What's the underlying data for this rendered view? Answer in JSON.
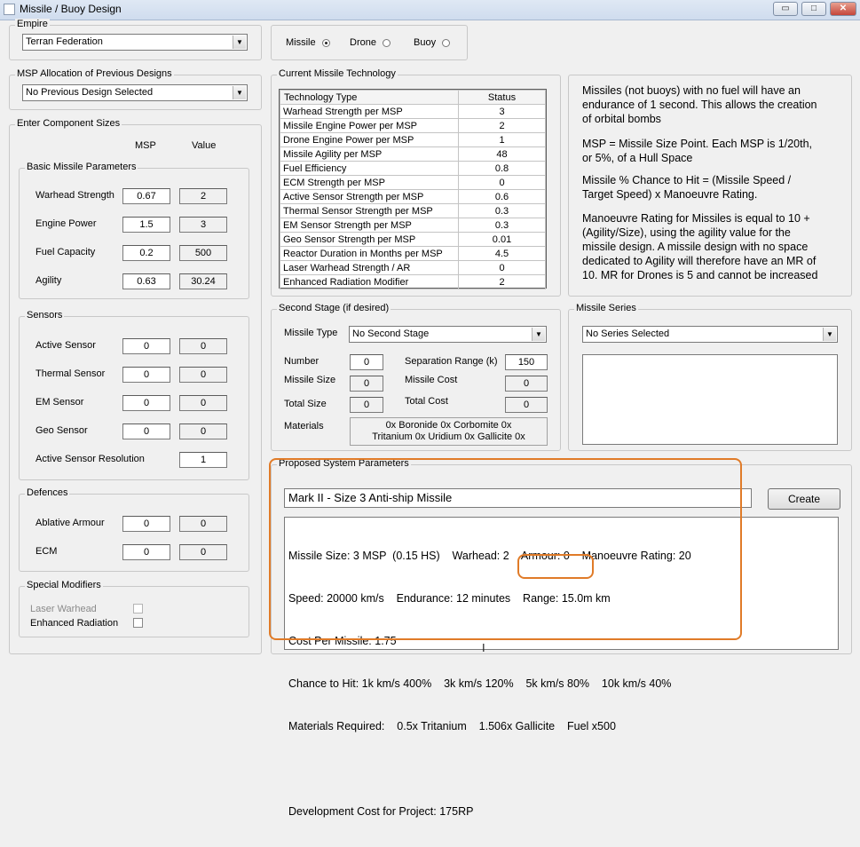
{
  "window": {
    "title": "Missile / Buoy Design",
    "min": "▭",
    "max": "□",
    "close": "✕"
  },
  "empire": {
    "legend": "Empire",
    "selected": "Terran Federation"
  },
  "msp_alloc": {
    "legend": "MSP Allocation of Previous Designs",
    "selected": "No Previous Design Selected"
  },
  "type_select": {
    "missile": "Missile",
    "drone": "Drone",
    "buoy": "Buoy",
    "selected": "Missile"
  },
  "components": {
    "legend": "Enter Component Sizes",
    "col_msp": "MSP",
    "col_value": "Value",
    "basic": {
      "legend": "Basic Missile Parameters",
      "rows": [
        {
          "label": "Warhead Strength",
          "msp": "0.67",
          "value": "2"
        },
        {
          "label": "Engine Power",
          "msp": "1.5",
          "value": "3"
        },
        {
          "label": "Fuel Capacity",
          "msp": "0.2",
          "value": "500"
        },
        {
          "label": "Agility",
          "msp": "0.63",
          "value": "30.24"
        }
      ]
    },
    "sensors": {
      "legend": "Sensors",
      "rows": [
        {
          "label": "Active Sensor",
          "msp": "0",
          "value": "0"
        },
        {
          "label": "Thermal Sensor",
          "msp": "0",
          "value": "0"
        },
        {
          "label": "EM Sensor",
          "msp": "0",
          "value": "0"
        },
        {
          "label": "Geo Sensor",
          "msp": "0",
          "value": "0"
        }
      ],
      "resolution_label": "Active Sensor Resolution",
      "resolution_value": "1"
    },
    "defences": {
      "legend": "Defences",
      "rows": [
        {
          "label": "Ablative Armour",
          "msp": "0",
          "value": "0"
        },
        {
          "label": "ECM",
          "msp": "0",
          "value": "0"
        }
      ]
    },
    "special": {
      "legend": "Special Modifiers",
      "laser": "Laser Warhead",
      "enhanced": "Enhanced Radiation"
    }
  },
  "tech": {
    "legend": "Current Missile Technology",
    "col_type": "Technology Type",
    "col_status": "Status",
    "rows": [
      {
        "type": "Warhead Strength per MSP",
        "status": "3"
      },
      {
        "type": "Missile Engine Power per MSP",
        "status": "2"
      },
      {
        "type": "Drone Engine Power per MSP",
        "status": "1"
      },
      {
        "type": "Missile Agility per MSP",
        "status": "48"
      },
      {
        "type": "Fuel Efficiency",
        "status": "0.8"
      },
      {
        "type": "ECM Strength per MSP",
        "status": "0"
      },
      {
        "type": "Active Sensor Strength per MSP",
        "status": "0.6"
      },
      {
        "type": "Thermal Sensor Strength per MSP",
        "status": "0.3"
      },
      {
        "type": "EM Sensor Strength per MSP",
        "status": "0.3"
      },
      {
        "type": "Geo Sensor Strength per MSP",
        "status": "0.01"
      },
      {
        "type": "Reactor Duration in Months per MSP",
        "status": "4.5"
      },
      {
        "type": "Laser Warhead Strength / AR",
        "status": "0"
      },
      {
        "type": "Enhanced Radiation Modifier",
        "status": "2"
      }
    ]
  },
  "info": {
    "p1": [
      "Missiles (not buoys) with no fuel will have an",
      "endurance of 1 second. This allows the creation",
      "of orbital bombs"
    ],
    "p2": [
      "MSP = Missile Size Point. Each MSP is 1/20th,",
      "or 5%, of a Hull Space"
    ],
    "p3": [
      "Missile % Chance to Hit = (Missile Speed /",
      "Target Speed) x Manoeuvre Rating."
    ],
    "p4": [
      "Manoeuvre Rating for Missiles is equal to 10 +",
      "(Agility/Size), using the agility value for the",
      "missile design. A missile design with no space",
      "dedicated to Agility will therefore have an MR of",
      "10. MR for Drones is 5 and cannot be increased"
    ]
  },
  "second_stage": {
    "legend": "Second Stage (if desired)",
    "missile_type_label": "Missile Type",
    "missile_type_value": "No Second Stage",
    "number_label": "Number",
    "number_value": "0",
    "sep_label": "Separation Range (k)",
    "sep_value": "150",
    "size_label": "Missile Size",
    "size_value": "0",
    "cost_label": "Missile Cost",
    "cost_value": "0",
    "total_size_label": "Total Size",
    "total_size_value": "0",
    "total_cost_label": "Total Cost",
    "total_cost_value": "0",
    "materials_label": "Materials",
    "materials_line1": "0x Boronide   0x Corbomite   0x",
    "materials_line2": "Tritanium   0x Uridium   0x Gallicite 0x"
  },
  "series": {
    "legend": "Missile Series",
    "selected": "No Series Selected"
  },
  "proposed": {
    "legend": "Proposed System Parameters",
    "name": "Mark II - Size 3 Anti-ship Missile",
    "create": "Create",
    "lines": [
      "Missile Size: 3 MSP  (0.15 HS)    Warhead: 2    Armour: 0    Manoeuvre Rating: 20",
      "Speed: 20000 km/s    Endurance: 12 minutes    Range: 15.0m km",
      "Cost Per Missile: 1.75",
      "Chance to Hit: 1k km/s 400%    3k km/s 120%    5k km/s 80%    10k km/s 40%",
      "Materials Required:    0.5x Tritanium    1.506x Gallicite    Fuel x500",
      "",
      "Development Cost for Project: 175RP"
    ]
  }
}
